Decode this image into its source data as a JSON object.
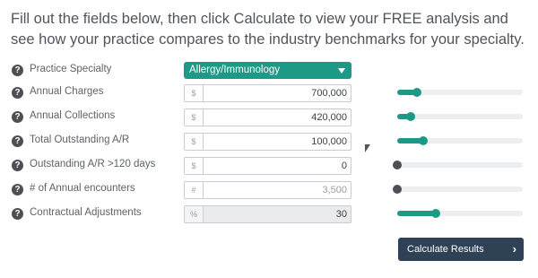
{
  "intro_text": "Fill out the fields below, then click Calculate to view your FREE analysis and see how your practice compares to the industry benchmarks for your specialty.",
  "help_glyph": "?",
  "specialty": {
    "label": "Practice Specialty",
    "selected": "Allergy/Immunology"
  },
  "fields": [
    {
      "label": "Annual Charges",
      "addon": "$",
      "value": "700,000",
      "slider_fraction": 0.16
    },
    {
      "label": "Annual Collections",
      "addon": "$",
      "value": "420,000",
      "slider_fraction": 0.11
    },
    {
      "label": "Total Outstanding A/R",
      "addon": "$",
      "value": "100,000",
      "slider_fraction": 0.21
    },
    {
      "label": "Outstanding A/R >120 days",
      "addon": "$",
      "value": "0",
      "slider_fraction": 0.0
    },
    {
      "label": "# of Annual encounters",
      "addon": "#",
      "value": "3,500",
      "slider_fraction": 0.0,
      "placeholder": true
    },
    {
      "label": "Contractual Adjustments",
      "addon": "%",
      "value": "30",
      "slider_fraction": 0.31,
      "disabled": true
    }
  ],
  "calculate_button": {
    "label": "Calculate Results",
    "chevron": "›"
  },
  "colors": {
    "accent": "#1c9a85",
    "button_bg": "#2f4155",
    "icon_bg": "#4d4f54"
  }
}
